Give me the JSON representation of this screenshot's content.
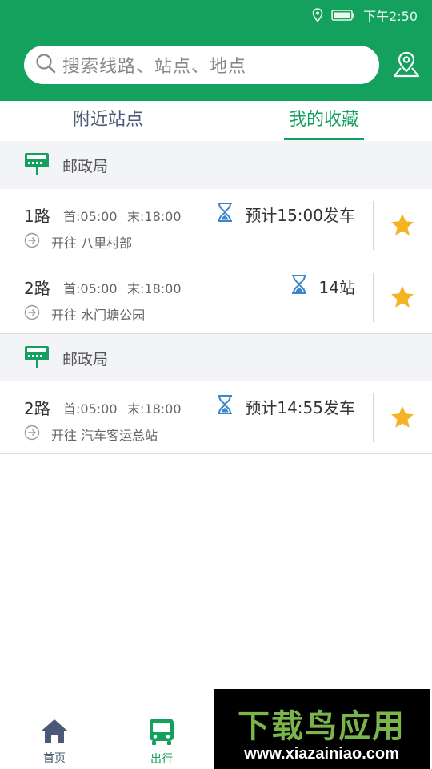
{
  "status_bar": {
    "time": "下午2:50"
  },
  "search": {
    "placeholder": "搜索线路、站点、地点"
  },
  "tabs": [
    {
      "label": "附近站点",
      "active": false
    },
    {
      "label": "我的收藏",
      "active": true
    }
  ],
  "favorites": [
    {
      "station": "邮政局",
      "routes": [
        {
          "line": "1路",
          "first": "首:05:00",
          "last": "末:18:00",
          "eta": "预计15:00发车",
          "direction": "开往 八里村部",
          "favorited": true
        },
        {
          "line": "2路",
          "first": "首:05:00",
          "last": "末:18:00",
          "eta": "14站",
          "direction": "开往 水门塘公园",
          "favorited": true
        }
      ]
    },
    {
      "station": "邮政局",
      "routes": [
        {
          "line": "2路",
          "first": "首:05:00",
          "last": "末:18:00",
          "eta": "预计14:55发车",
          "direction": "开往 汽车客运总站",
          "favorited": true
        }
      ]
    }
  ],
  "bottom_nav": [
    {
      "label": "首页",
      "icon": "home-icon",
      "active": false
    },
    {
      "label": "出行",
      "icon": "bus-icon",
      "active": true
    }
  ],
  "watermark": {
    "title": "下载鸟应用",
    "url": "www.xiazainiao.com"
  },
  "colors": {
    "brand": "#14a05d",
    "star": "#f5b324",
    "hourglass": "#3a86c8",
    "station_icon": "#14a05d",
    "inactive": "#4a5a76"
  }
}
